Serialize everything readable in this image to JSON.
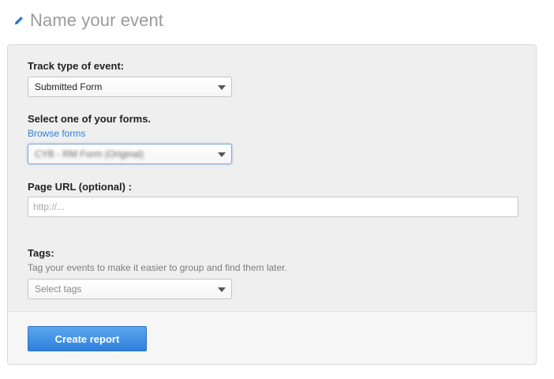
{
  "header": {
    "title": "Name your event",
    "icon": "pencil-icon",
    "icon_color": "#2f7fd8"
  },
  "form": {
    "event_type": {
      "label": "Track type of event:",
      "selected": "Submitted Form"
    },
    "form_select": {
      "label": "Select one of your forms.",
      "browse_link": "Browse forms",
      "selected": "CYB - RM Form (Original)"
    },
    "page_url": {
      "label": "Page URL (optional) :",
      "value": "",
      "placeholder": "http://..."
    },
    "tags": {
      "label": "Tags:",
      "hint": "Tag your events to make it easier to group and find them later.",
      "placeholder": "Select tags"
    }
  },
  "footer": {
    "create_button_label": "Create report",
    "button_color": "#2f80db"
  }
}
